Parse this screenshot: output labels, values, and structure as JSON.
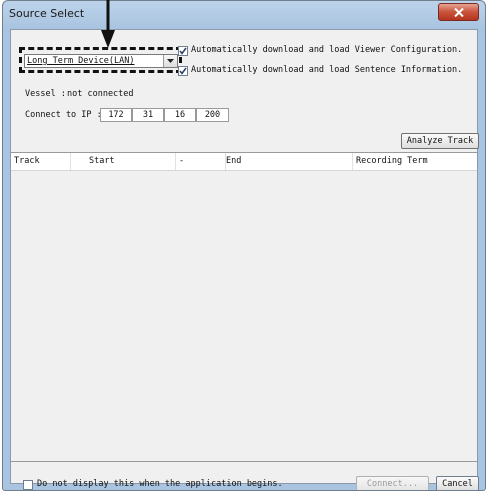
{
  "window": {
    "title": "Source Select"
  },
  "source": {
    "selected": "Long Term Device(LAN)"
  },
  "options": [
    {
      "label": "Automatically download and load Viewer Configuration.",
      "checked": true
    },
    {
      "label": "Automatically download and load Sentence Information.",
      "checked": true
    }
  ],
  "vessel": {
    "label": "Vessel :",
    "status": "not connected"
  },
  "connect_ip": {
    "label": "Connect to IP :",
    "octets": [
      "172",
      "31",
      "16",
      "200"
    ]
  },
  "analyze_button": "Analyze Track",
  "table": {
    "columns": [
      "Track",
      "Start",
      "-",
      "End",
      "Recording Term"
    ],
    "rows": []
  },
  "footer": {
    "dont_show_label": "Do not display this when the application begins.",
    "dont_show_checked": false,
    "connect_button": "Connect...",
    "cancel_button": "Cancel"
  },
  "colors": {
    "titlebar": "#a9c4e0",
    "close_button": "#c9533b",
    "client_bg": "#f0f0f0"
  },
  "icons": {
    "close": "close-x-icon",
    "dropdown": "chevron-down-icon",
    "check": "checkmark-icon",
    "pointer": "down-arrow-icon"
  }
}
